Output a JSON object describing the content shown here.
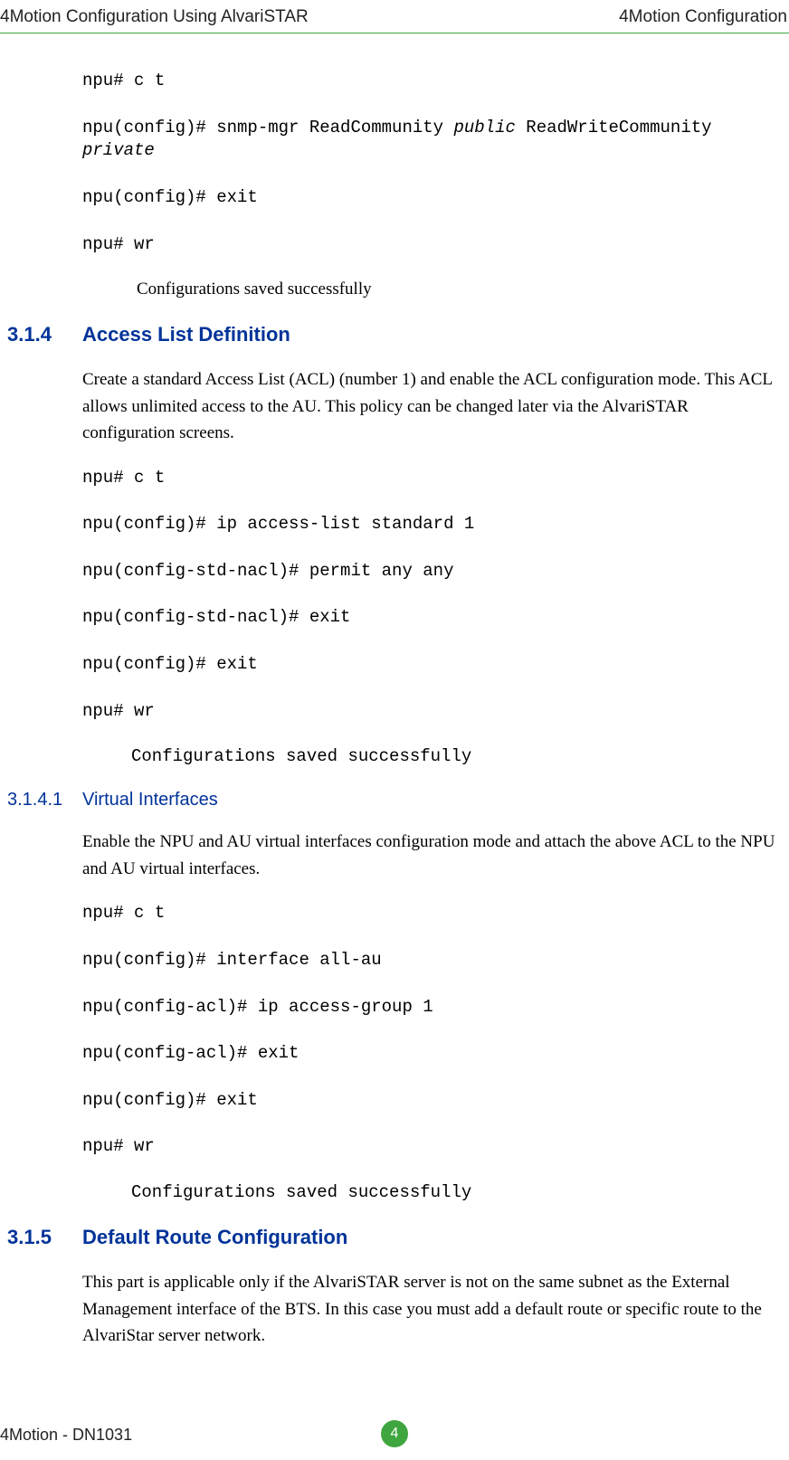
{
  "header": {
    "left": "4Motion Configuration Using AlvariSTAR",
    "right": "4Motion Configuration"
  },
  "block1": {
    "l1": "npu# c t",
    "l2a": "npu(config)# snmp-mgr ReadCommunity ",
    "l2b": "public",
    "l2c": " ReadWriteCommunity ",
    "l2d": "private",
    "l3": "npu(config)# exit",
    "l4": "npu# wr",
    "l5": "Configurations saved successfully"
  },
  "sec314": {
    "num": "3.1.4",
    "title": "Access List Definition",
    "para": "Create a standard Access List (ACL) (number 1) and enable the ACL configuration mode. This ACL allows unlimited access to the AU. This policy can be changed later via the AlvariSTAR configuration screens.",
    "l1": "npu# c t",
    "l2": "npu(config)# ip access-list standard 1",
    "l3": "npu(config-std-nacl)# permit any any",
    "l4": "npu(config-std-nacl)# exit",
    "l5": "npu(config)# exit",
    "l6": "npu# wr",
    "l7": "Configurations saved successfully"
  },
  "sec3141": {
    "num": "3.1.4.1",
    "title": "Virtual Interfaces",
    "para": "Enable the NPU and AU virtual interfaces configuration mode and attach the above ACL to the NPU and AU virtual interfaces.",
    "l1": "npu# c t",
    "l2": "npu(config)# interface all-au",
    "l3": "npu(config-acl)# ip access-group 1",
    "l4": "npu(config-acl)# exit",
    "l5": "npu(config)# exit",
    "l6": "npu# wr",
    "l7": "Configurations saved successfully"
  },
  "sec315": {
    "num": "3.1.5",
    "title": "Default Route Configuration",
    "para": "This part is applicable only if the AlvariSTAR server is not on the same subnet as the External Management interface of the BTS. In this case you must add a default route or specific route to the AlvariStar server network."
  },
  "footer": {
    "text": "4Motion - DN1031",
    "page": "4"
  }
}
